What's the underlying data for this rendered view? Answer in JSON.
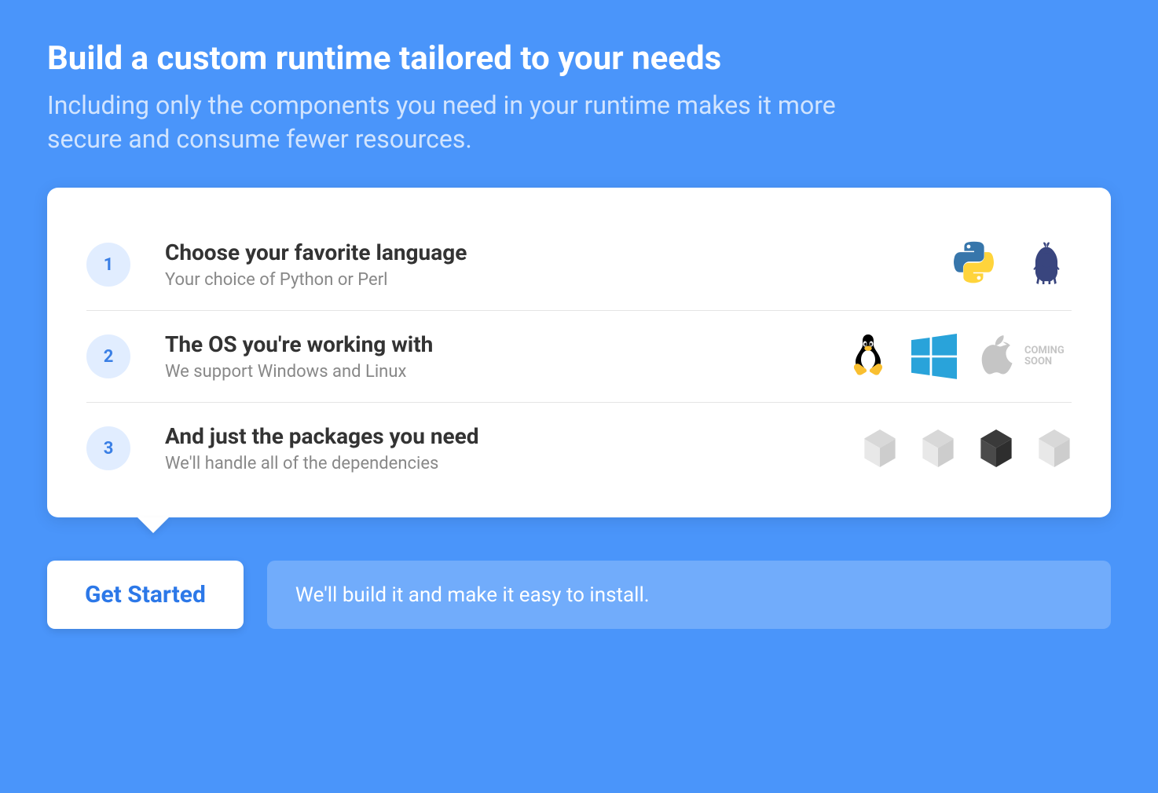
{
  "header": {
    "title": "Build a custom runtime tailored to your needs",
    "subtitle": "Including only the components you need in your runtime makes it more secure and consume fewer resources."
  },
  "steps": [
    {
      "number": "1",
      "title": "Choose your favorite language",
      "subtitle": "Your choice of Python or Perl"
    },
    {
      "number": "2",
      "title": "The OS you're working with",
      "subtitle": "We support Windows and Linux"
    },
    {
      "number": "3",
      "title": "And just the packages you need",
      "subtitle": "We'll handle all of the dependencies"
    }
  ],
  "coming_soon_label": "COMING SOON",
  "footer": {
    "cta_label": "Get Started",
    "note": "We'll build it and make it easy to install."
  },
  "icons": {
    "languages": [
      "python",
      "perl"
    ],
    "os": [
      "linux",
      "windows",
      "apple"
    ],
    "packages": [
      "package-light",
      "package-light",
      "package-dark",
      "package-light"
    ]
  }
}
